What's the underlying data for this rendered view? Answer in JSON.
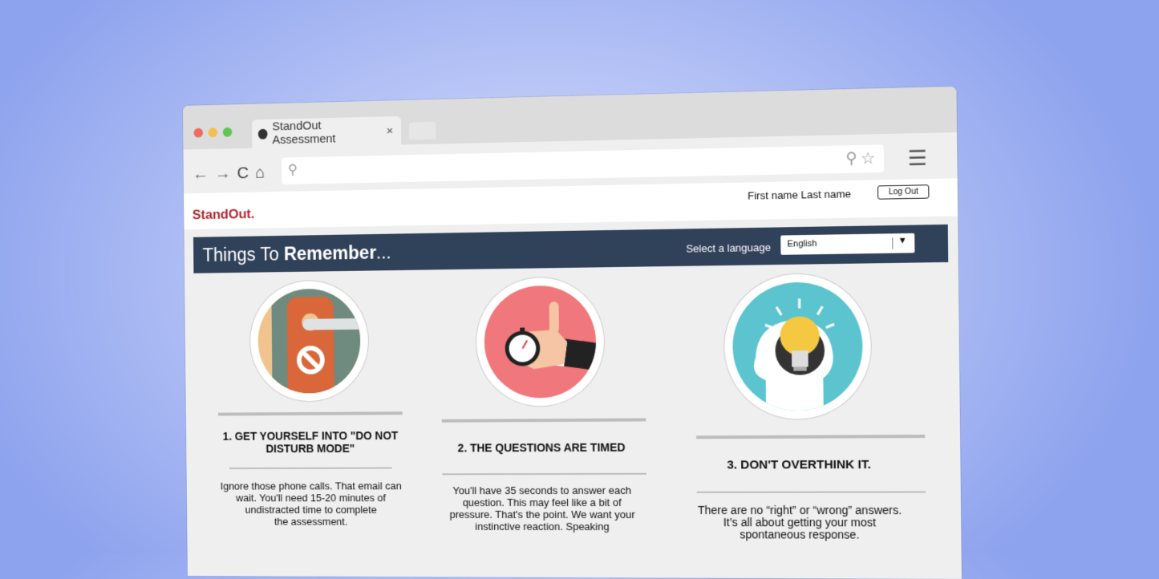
{
  "browser": {
    "tab_title": "StandOut Assessment",
    "tab_close": "×",
    "nav": {
      "back": "←",
      "forward": "→",
      "reload": "C",
      "home": "⌂"
    },
    "url_search_icon": "search-icon",
    "menu_icon": "hamburger-icon"
  },
  "site": {
    "brand": "StandOut",
    "brand_dot": ".",
    "user_name": "First name Last name",
    "logout_label": "Log Out"
  },
  "banner": {
    "title_prefix": "Things To ",
    "title_bold": "Remember",
    "title_suffix": "...",
    "language_label": "Select a language",
    "language_value": "English"
  },
  "tips": [
    {
      "heading_line1": "1. GET YOURSELF INTO \"DO NOT",
      "heading_line2": "DISTURB MODE\"",
      "body": [
        "Ignore those phone calls. That email can",
        "wait. You'll need 15-20 minutes of",
        "undistracted time to complete",
        "the assessment."
      ],
      "icon": "do-not-disturb-icon"
    },
    {
      "heading": "2. THE QUESTIONS ARE TIMED",
      "body": [
        "You'll have 35 seconds to answer each",
        "question. This may feel like a bit of",
        "pressure. That's the point. We want your",
        "instinctive reaction. Speaking"
      ],
      "icon": "stopwatch-icon"
    },
    {
      "heading": "3. DON'T OVERTHINK IT.",
      "body": [
        "There are no “right” or “wrong” answers.",
        "It’s all about getting your most",
        "spontaneous response."
      ],
      "icon": "lightbulb-head-icon"
    }
  ],
  "colors": {
    "background": "#8ea3ee",
    "brand_red": "#b0282e",
    "banner": "#30415a"
  }
}
